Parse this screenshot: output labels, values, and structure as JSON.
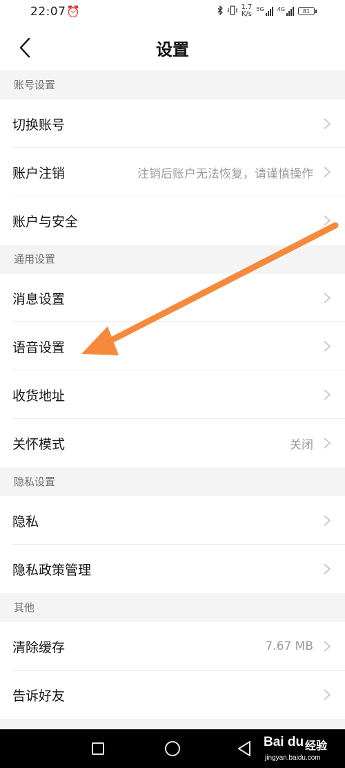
{
  "status_bar": {
    "time": "22:07",
    "alarm_icon": "alarm-clock-icon",
    "speed_value": "1.7",
    "speed_unit": "K/s",
    "sim1_label": "5G",
    "sim2_label": "4G",
    "battery": "81",
    "icons": [
      "bluetooth-icon",
      "vibrate-icon",
      "signal-icon",
      "battery-icon"
    ]
  },
  "header": {
    "title": "设置",
    "back_icon": "chevron-left-icon"
  },
  "sections": [
    {
      "title": "账号设置",
      "items": [
        {
          "label": "切换账号",
          "value": ""
        },
        {
          "label": "账户注销",
          "value": "注销后账户无法恢复，请谨慎操作"
        },
        {
          "label": "账户与安全",
          "value": ""
        }
      ]
    },
    {
      "title": "通用设置",
      "items": [
        {
          "label": "消息设置",
          "value": ""
        },
        {
          "label": "语音设置",
          "value": ""
        },
        {
          "label": "收货地址",
          "value": ""
        },
        {
          "label": "关怀模式",
          "value": "关闭"
        }
      ]
    },
    {
      "title": "隐私设置",
      "items": [
        {
          "label": "隐私",
          "value": ""
        },
        {
          "label": "隐私政策管理",
          "value": ""
        }
      ]
    },
    {
      "title": "其他",
      "items": [
        {
          "label": "清除缓存",
          "value": "7.67 MB"
        },
        {
          "label": "告诉好友",
          "value": ""
        }
      ]
    }
  ],
  "system_nav": {
    "recent_icon": "square-icon",
    "home_icon": "circle-icon",
    "back_icon": "triangle-back-icon"
  },
  "watermark": {
    "logo": "Bai du",
    "text": "经验",
    "url": "jingyan.baidu.com"
  },
  "colors": {
    "arrow": "#f5893c",
    "background": "#f4f4f4",
    "secondary_text": "#9a9a9a"
  }
}
